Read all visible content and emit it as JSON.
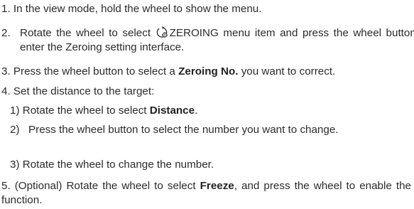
{
  "steps": [
    {
      "num": "1.",
      "text": "In the view mode, hold the wheel to show the menu."
    },
    {
      "num": "2.",
      "pre": "Rotate the wheel to select",
      "icon": "zeroing-icon",
      "post": "ZEROING menu item and press the wheel button to enter the Zeroing setting interface."
    },
    {
      "num": "3.",
      "pre": "Press the wheel button to select a",
      "bold": "Zeroing No.",
      "post": "you want to correct."
    },
    {
      "num": "4.",
      "text": "Set the distance to the target:",
      "substeps": [
        {
          "num": "1)",
          "pre": "Rotate the wheel to select",
          "bold": "Distance",
          "post": "."
        },
        {
          "num": "2)",
          "text": "Press the wheel button to select the number you want to change."
        },
        {
          "num": "3)",
          "text": "Rotate the wheel to change the number."
        }
      ]
    },
    {
      "num": "5.",
      "pre": "(Optional) Rotate the wheel to select",
      "bold": "Freeze",
      "post": ", and press the wheel to enable the function."
    }
  ]
}
